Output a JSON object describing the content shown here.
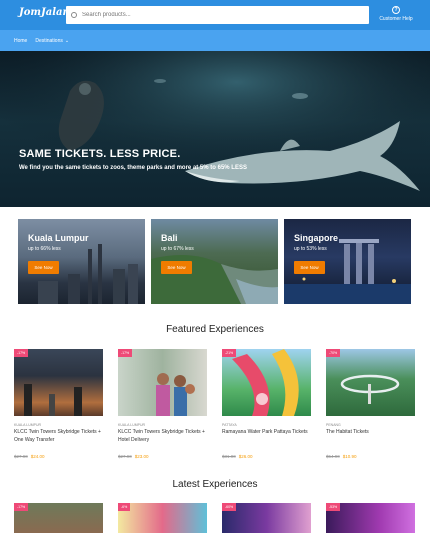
{
  "header": {
    "logo": "JomJalan",
    "search_placeholder": "Search products...",
    "help_label": "Customer Help"
  },
  "nav": {
    "home": "Home",
    "destinations": "Destinations"
  },
  "hero": {
    "title": "SAME TICKETS. LESS PRICE.",
    "subtitle": "We find you the same tickets to zoos, theme parks and more at 5% to 65% LESS"
  },
  "destinations": [
    {
      "name": "Kuala Lumpur",
      "discount": "up to 66% less",
      "button": "See Now"
    },
    {
      "name": "Bali",
      "discount": "up to 67% less",
      "button": "See Now"
    },
    {
      "name": "Singapore",
      "discount": "up to 53% less",
      "button": "See Now"
    }
  ],
  "featured": {
    "title": "Featured Experiences",
    "items": [
      {
        "badge": "-17%",
        "location": "KUALA LUMPUR",
        "name": "KLCC Twin Towers Skybridge Tickets + One Way Transfer",
        "old_price": "$27.90",
        "new_price": "$24.00"
      },
      {
        "badge": "-17%",
        "location": "KUALA LUMPUR",
        "name": "KLCC Twin Towers Skybridge Tickets + Hotel Delivery",
        "old_price": "$27.90",
        "new_price": "$23.00"
      },
      {
        "badge": "-21%",
        "location": "PATTAYA",
        "name": "Ramayana Water Park Pattaya Tickets",
        "old_price": "$31.00",
        "new_price": "$26.00"
      },
      {
        "badge": "-70%",
        "location": "PENANG",
        "name": "The Habitat Tickets",
        "old_price": "$54.90",
        "new_price": "$10.90"
      }
    ]
  },
  "latest": {
    "title": "Latest Experiences",
    "items": [
      {
        "badge": "-17%"
      },
      {
        "badge": "-6%"
      },
      {
        "badge": "-60%"
      },
      {
        "badge": "-53%"
      }
    ]
  }
}
